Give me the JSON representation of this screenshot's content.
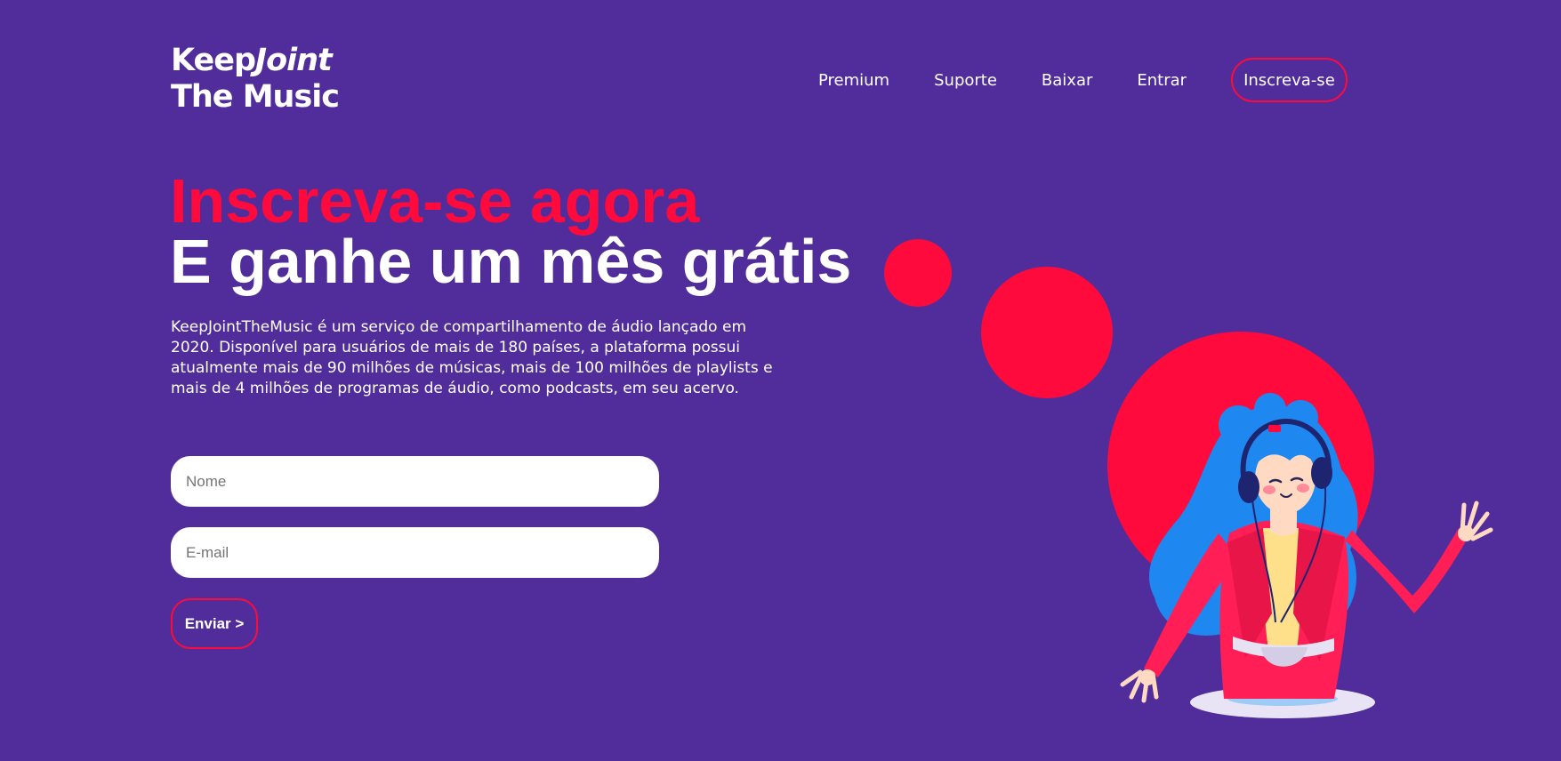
{
  "brand": {
    "logo_line1_regular": "Keep",
    "logo_line1_italic": "Joint",
    "logo_line2": "The Music"
  },
  "nav": {
    "links": [
      "Premium",
      "Suporte",
      "Baixar",
      "Entrar"
    ],
    "cta_label": "Inscreva-se"
  },
  "hero": {
    "headline_red": "Inscreva-se agora",
    "headline_white": "E ganhe um mês grátis",
    "description": "KeepJointTheMusic é um serviço de compartilhamento de áudio lançado em 2020. Disponível para usuários de mais de 180 países, a plataforma possui atualmente mais de 90 milhões de músicas, mais de 100 milhões de playlists e mais de 4 milhões de programas de áudio, como podcasts, em seu acervo."
  },
  "form": {
    "name_placeholder": "Nome",
    "email_placeholder": "E-mail",
    "submit_label": "Enviar >"
  },
  "colors": {
    "background": "#512d9b",
    "accent": "#ff0a3c",
    "text": "#ffffff",
    "hair": "#1e88f0",
    "jacket": "#ff1e55"
  },
  "illustration": {
    "description": "girl-with-headphones-dancing"
  }
}
